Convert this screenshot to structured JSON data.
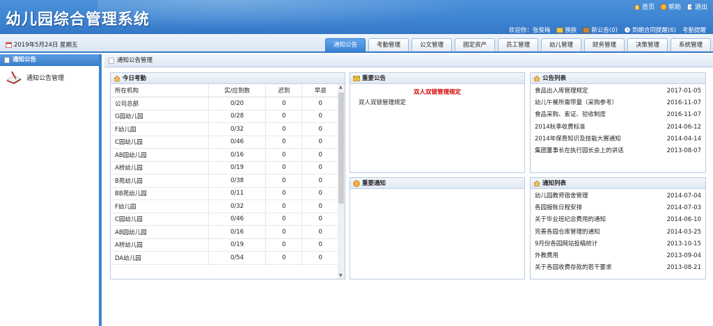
{
  "header": {
    "title": "幼儿园综合管理系统",
    "top_links": [
      "首页",
      "帮助",
      "退出"
    ],
    "welcome": "欢迎你：张俊梅",
    "actions": [
      "换肤",
      "新公告(0)",
      "到期合同提醒(6)",
      "考勤提醒"
    ]
  },
  "date": "2019年5月24日 星期五",
  "tabs": [
    {
      "label": "通知公告",
      "active": true
    },
    {
      "label": "考勤管理",
      "active": false
    },
    {
      "label": "公文管理",
      "active": false
    },
    {
      "label": "固定资产",
      "active": false
    },
    {
      "label": "员工管理",
      "active": false
    },
    {
      "label": "幼儿管理",
      "active": false
    },
    {
      "label": "财务管理",
      "active": false
    },
    {
      "label": "决策管理",
      "active": false
    },
    {
      "label": "系统管理",
      "active": false
    }
  ],
  "sidebar": {
    "title": "通知公告",
    "item": "通知公告管理"
  },
  "main": {
    "title": "通知公告管理"
  },
  "attendance": {
    "title": "今日考勤",
    "columns": [
      "所在机构",
      "实/应到数",
      "迟到",
      "早退"
    ],
    "rows": [
      [
        "公司总部",
        "0/20",
        "0",
        "0"
      ],
      [
        "G园幼儿园",
        "0/28",
        "0",
        "0"
      ],
      [
        "F幼儿园",
        "0/32",
        "0",
        "0"
      ],
      [
        "C园幼儿园",
        "0/46",
        "0",
        "0"
      ],
      [
        "AB园幼儿园",
        "0/16",
        "0",
        "0"
      ],
      [
        "A桥幼儿园",
        "0/19",
        "0",
        "0"
      ],
      [
        "B苑幼儿园",
        "0/38",
        "0",
        "0"
      ],
      [
        "BB苑幼儿园",
        "0/11",
        "0",
        "0"
      ],
      [
        "F幼儿园",
        "0/32",
        "0",
        "0"
      ],
      [
        "C园幼儿园",
        "0/46",
        "0",
        "0"
      ],
      [
        "AB园幼儿园",
        "0/16",
        "0",
        "0"
      ],
      [
        "A桥幼儿园",
        "0/19",
        "0",
        "0"
      ],
      [
        "DA幼儿园",
        "0/54",
        "0",
        "0"
      ]
    ]
  },
  "important_announcement": {
    "title": "重要公告",
    "headline": "双人双锁管理规定",
    "body": "双人双锁管理规定"
  },
  "important_notice": {
    "title": "重要通知"
  },
  "announcement_list": {
    "title": "公告列表",
    "items": [
      {
        "title": "食品出入库管理规定",
        "date": "2017-01-05"
      },
      {
        "title": "幼儿午餐所需带量（采购参考）",
        "date": "2016-11-07"
      },
      {
        "title": "食品采购、索证、验收制度",
        "date": "2016-11-07"
      },
      {
        "title": "2014秋季收费标准",
        "date": "2014-06-12"
      },
      {
        "title": "2014年保育知识及技能大赛通知",
        "date": "2014-04-14"
      },
      {
        "title": "集团董事长在执行园长会上的讲话",
        "date": "2013-08-07"
      }
    ]
  },
  "notice_list": {
    "title": "通知列表",
    "items": [
      {
        "title": "幼儿园教师宿舍管理",
        "date": "2014-07-04"
      },
      {
        "title": "各园报账日程安排",
        "date": "2014-07-03"
      },
      {
        "title": "关于毕业班纪念费用的通知",
        "date": "2014-06-10"
      },
      {
        "title": "完善各园仓库管理的通知",
        "date": "2014-03-25"
      },
      {
        "title": "9月份各园网站投稿统计",
        "date": "2013-10-15"
      },
      {
        "title": "外教费用",
        "date": "2013-09-04"
      },
      {
        "title": "关于各园收费存款的若干要求",
        "date": "2013-08-21"
      }
    ]
  },
  "colors": {
    "header_blue": "#3d84d2",
    "tab_active": "#3a83d4",
    "headline_red": "#d40000"
  }
}
